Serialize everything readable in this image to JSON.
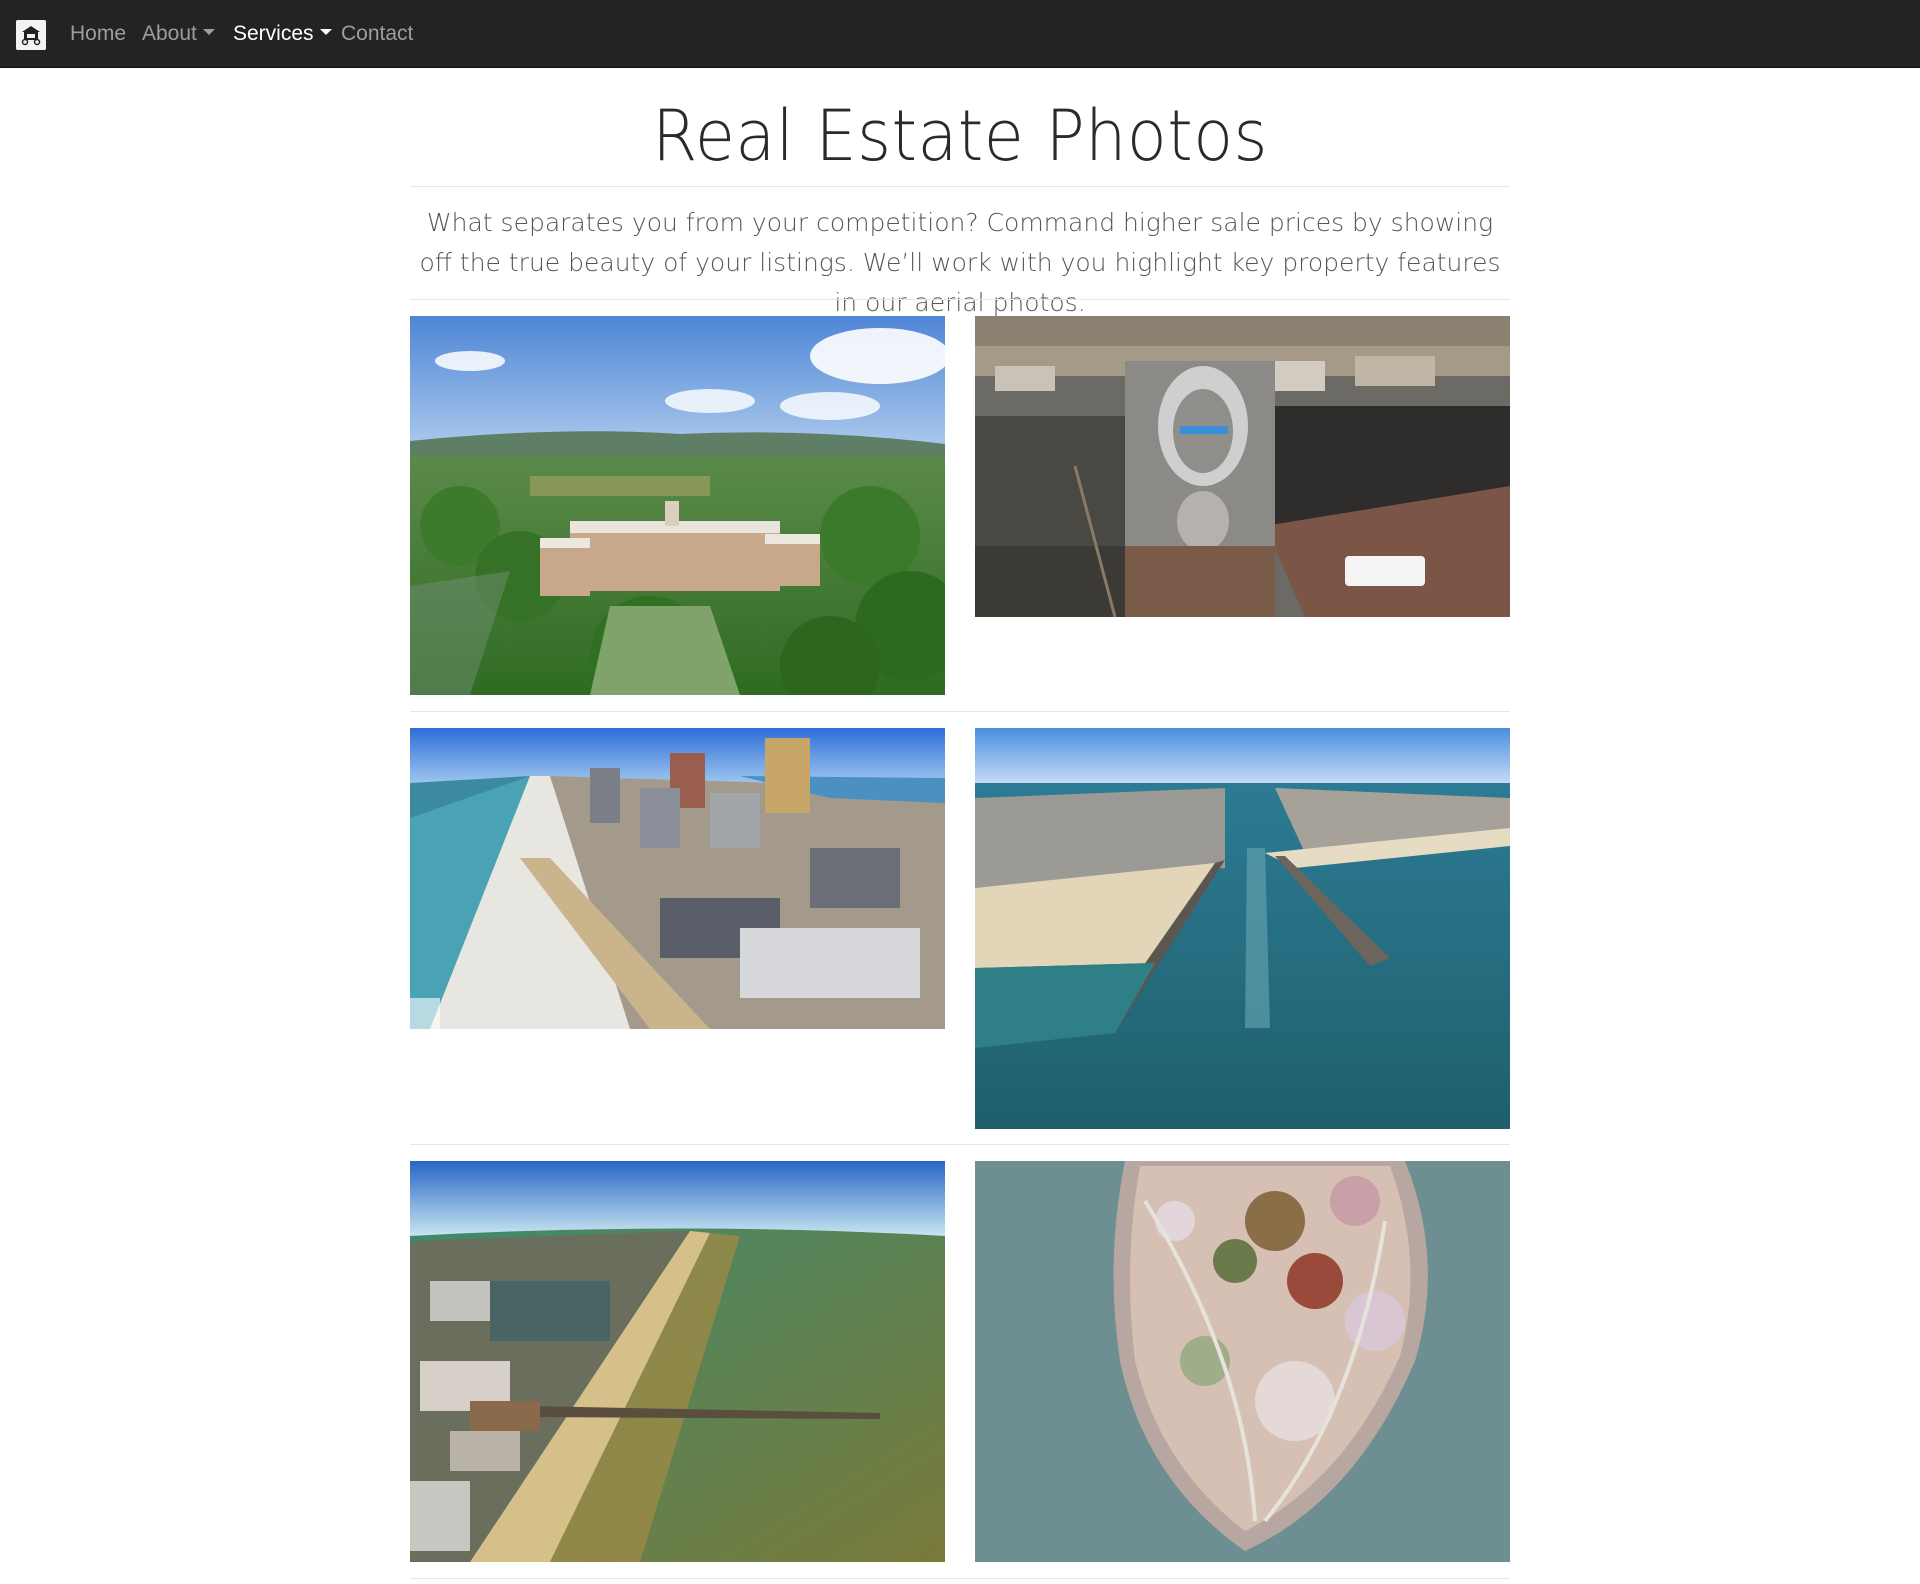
{
  "navbar": {
    "brand_icon": "drone-logo-icon",
    "items": [
      {
        "label": "Home",
        "dropdown": false,
        "active": false
      },
      {
        "label": "About",
        "dropdown": true,
        "active": false
      },
      {
        "label": "Services",
        "dropdown": true,
        "active": true
      },
      {
        "label": "Contact",
        "dropdown": false,
        "active": false
      }
    ]
  },
  "page": {
    "title": "Real Estate Photos",
    "lead": "What separates you from your competition? Command higher sale prices by showing off the true beauty of your listings. We’ll work with you highlight key property features in our aerial photos."
  },
  "gallery": [
    {
      "name": "aerial-school-building-photo"
    },
    {
      "name": "aerial-mural-building-photo"
    },
    {
      "name": "aerial-beach-city-photo"
    },
    {
      "name": "aerial-inlet-jetty-photo"
    },
    {
      "name": "aerial-boardwalk-pier-photo"
    },
    {
      "name": "aerial-island-park-photo"
    }
  ],
  "colors": {
    "navbar_bg": "#222324",
    "nav_text": "#9d9d9d",
    "nav_active": "#ffffff"
  }
}
